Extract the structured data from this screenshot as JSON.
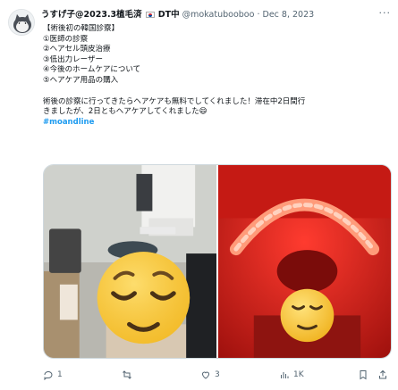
{
  "tweet": {
    "display_name": "うすげ子@2023.3植毛済",
    "flag_alt": "Korea flag",
    "name_suffix": "DT中",
    "handle": "@mokatubooboo",
    "separator": "·",
    "date": "Dec 8, 2023",
    "lines": [
      "【術後初の韓国診察】",
      "①医師の診察",
      "②ヘアセル頭皮治療",
      "③低出力レーザー",
      "④今後のホームケアについて",
      "⑤ヘアケア用品の購入"
    ],
    "paragraph": [
      "術後の診察に行ってきたらヘアケアも無料でしてくれました！滞在中2日間行",
      "きましたが、2日ともヘアケアしてくれました😄"
    ],
    "hashtag": "#moandline"
  },
  "media": {
    "photos": [
      {
        "alt": "Salon chair with treatment device, emoji face covering person"
      },
      {
        "alt": "Red LED light therapy device, emoji face covering person"
      }
    ]
  },
  "actions": {
    "reply_count": "1",
    "retweet_count": "",
    "like_count": "3",
    "views_count": "1K",
    "icons": [
      "reply-icon",
      "retweet-icon",
      "heart-icon",
      "views-icon",
      "bookmark-icon",
      "share-icon"
    ]
  },
  "colors": {
    "link": "#1d9bf0",
    "muted": "#536471",
    "red_light": "#e32b20"
  }
}
